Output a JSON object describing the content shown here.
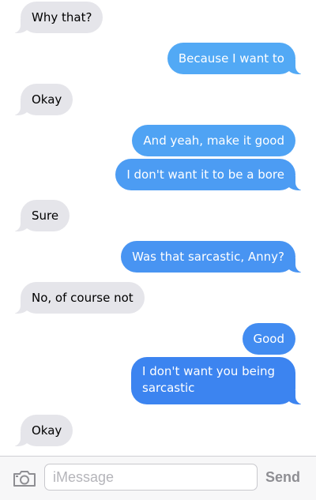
{
  "colors": {
    "received_bubble": "#e5e5ea",
    "sent_light": "#52a9f5",
    "sent_mid": "#4a97f2",
    "sent_dark": "#3c84f0"
  },
  "messages": [
    {
      "from": "received",
      "text": "Why that?"
    },
    {
      "from": "sent",
      "text": "Because I want to"
    },
    {
      "from": "received",
      "text": "Okay"
    },
    {
      "from": "sent",
      "text": "And yeah, make it good"
    },
    {
      "from": "sent",
      "text": "I don't want it to be a bore"
    },
    {
      "from": "received",
      "text": "Sure"
    },
    {
      "from": "sent",
      "text": "Was that sarcastic, Anny?"
    },
    {
      "from": "received",
      "text": "No, of course not"
    },
    {
      "from": "sent",
      "text": "Good"
    },
    {
      "from": "sent",
      "text": "I don't want you being sarcastic"
    },
    {
      "from": "received",
      "text": "Okay"
    }
  ],
  "composer": {
    "camera_icon": "camera-icon",
    "placeholder": "iMessage",
    "send_label": "Send"
  }
}
